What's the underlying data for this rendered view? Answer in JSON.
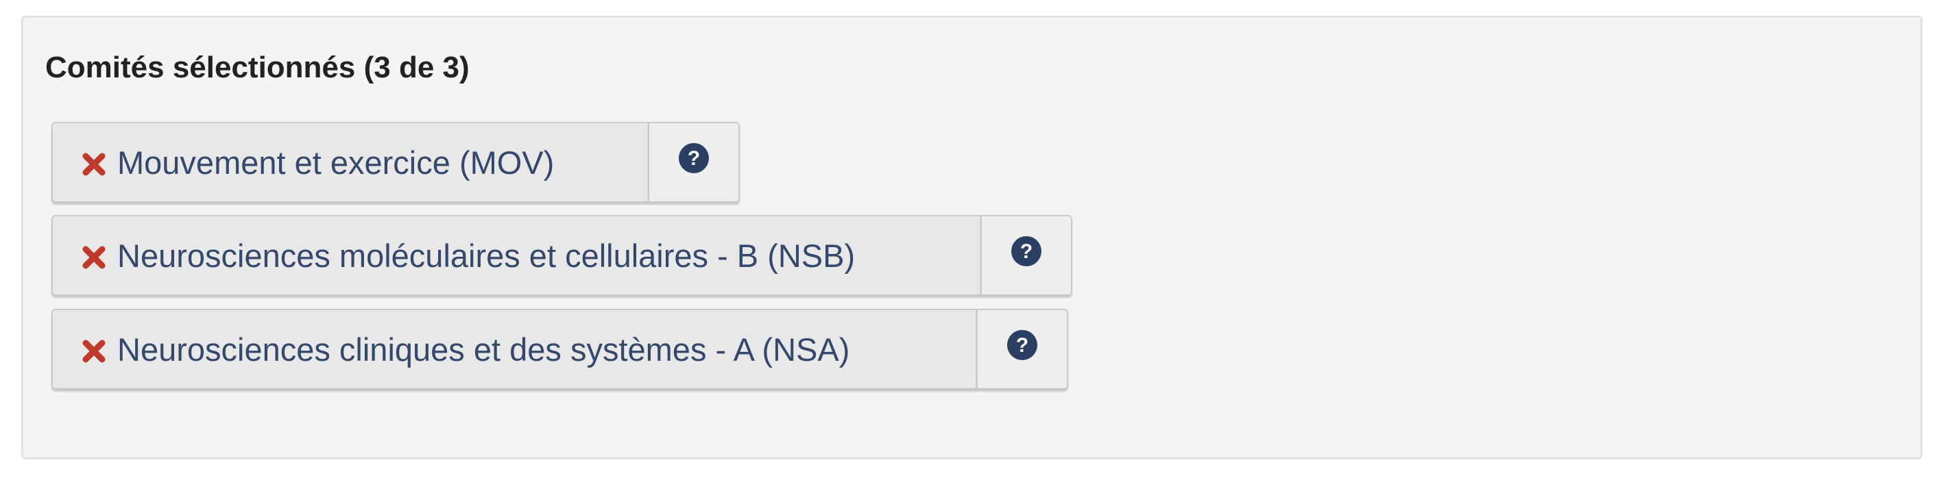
{
  "panel": {
    "title": "Comités sélectionnés (3 de 3)"
  },
  "committees": [
    {
      "label": "Mouvement et exercice (MOV)"
    },
    {
      "label": "Neurosciences moléculaires et cellulaires - B (NSB)"
    },
    {
      "label": "Neurosciences cliniques et des systèmes - A (NSA)"
    }
  ],
  "icons": {
    "remove": "close-icon",
    "help": "question-circle-icon"
  },
  "colors": {
    "remove_icon": "#c0392b",
    "label_text": "#34486b",
    "help_icon": "#2b3f63",
    "panel_background": "#f4f4f4",
    "chip_background": "#e8e8e8"
  }
}
